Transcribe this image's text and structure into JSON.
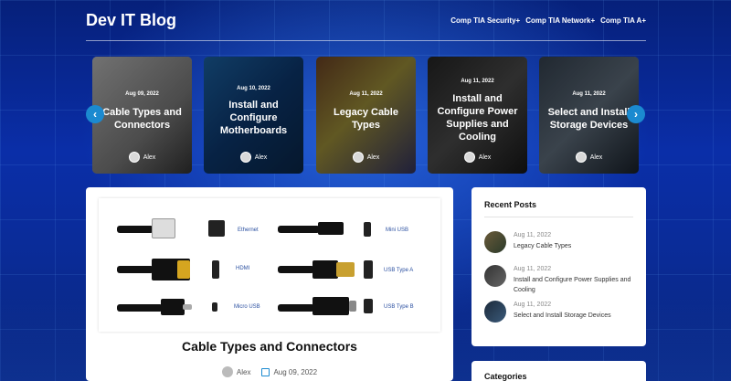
{
  "site": {
    "brand": "Dev IT Blog"
  },
  "nav": {
    "items": [
      "Comp TIA Security+",
      "Comp TIA Network+",
      "Comp TIA A+"
    ]
  },
  "carousel": {
    "cards": [
      {
        "date": "Aug 09, 2022",
        "title": "Cable Types and Connectors",
        "author": "Alex"
      },
      {
        "date": "Aug 10, 2022",
        "title": "Install and Configure Motherboards",
        "author": "Alex"
      },
      {
        "date": "Aug 11, 2022",
        "title": "Legacy Cable Types",
        "author": "Alex"
      },
      {
        "date": "Aug 11, 2022",
        "title": "Install and Configure Power Supplies and Cooling",
        "author": "Alex"
      },
      {
        "date": "Aug 11, 2022",
        "title": "Select and Install Storage Devices",
        "author": "Alex"
      }
    ]
  },
  "post": {
    "title": "Cable Types and Connectors",
    "author": "Alex",
    "date": "Aug 09, 2022",
    "image_labels": [
      "Ethernet",
      "Mini USB",
      "HDMI",
      "USB Type A",
      "Micro USB",
      "USB Type B"
    ]
  },
  "sidebar": {
    "recent_title": "Recent Posts",
    "recent": [
      {
        "date": "Aug 11, 2022",
        "title": "Legacy Cable Types"
      },
      {
        "date": "Aug 11, 2022",
        "title": "Install and Configure Power Supplies and Cooling"
      },
      {
        "date": "Aug 11, 2022",
        "title": "Select and Install Storage Devices"
      }
    ],
    "categories_title": "Categories"
  }
}
